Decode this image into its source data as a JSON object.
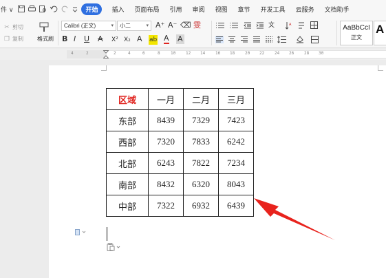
{
  "menubar": {
    "file_label": "件 ∨",
    "items": [
      "开始",
      "插入",
      "页面布局",
      "引用",
      "审阅",
      "视图",
      "章节",
      "开发工具",
      "云服务",
      "文档助手"
    ],
    "active_index": 0,
    "active_color": "#2f6fe0"
  },
  "ribbon": {
    "cut_label": "剪切",
    "copy_label": "复制",
    "format_painter_label": "格式刷",
    "font_name": "Calibri (正文)",
    "font_size": "小二",
    "grow_font": "A⁺",
    "shrink_font": "A⁻",
    "clear_format": "⌫",
    "phonetic": "雯",
    "bold": "B",
    "italic": "I",
    "underline": "U",
    "strike": "A",
    "superscript": "X²",
    "subscript": "X₂",
    "font_color_a": "A",
    "highlight": "ab",
    "font_color": "A",
    "char_shade": "A",
    "style_sample": "AaBbCcI",
    "style_name": "正文",
    "style_sample_2": "A"
  },
  "ruler": {
    "ticks": [
      "4",
      "2",
      "2",
      "4",
      "6",
      "8",
      "10",
      "12",
      "14",
      "16",
      "18",
      "20",
      "22",
      "24",
      "26",
      "28",
      "30"
    ]
  },
  "table": {
    "headers": [
      "区域",
      "一月",
      "二月",
      "三月"
    ],
    "header_accent_color": "#e0241f",
    "rows": [
      [
        "东部",
        "8439",
        "7329",
        "7423"
      ],
      [
        "西部",
        "7320",
        "7833",
        "6242"
      ],
      [
        "北部",
        "6243",
        "7822",
        "7234"
      ],
      [
        "南部",
        "8432",
        "6320",
        "8043"
      ],
      [
        "中部",
        "7322",
        "6932",
        "6439"
      ]
    ]
  },
  "annotation": {
    "arrow_color": "#e8231d"
  }
}
